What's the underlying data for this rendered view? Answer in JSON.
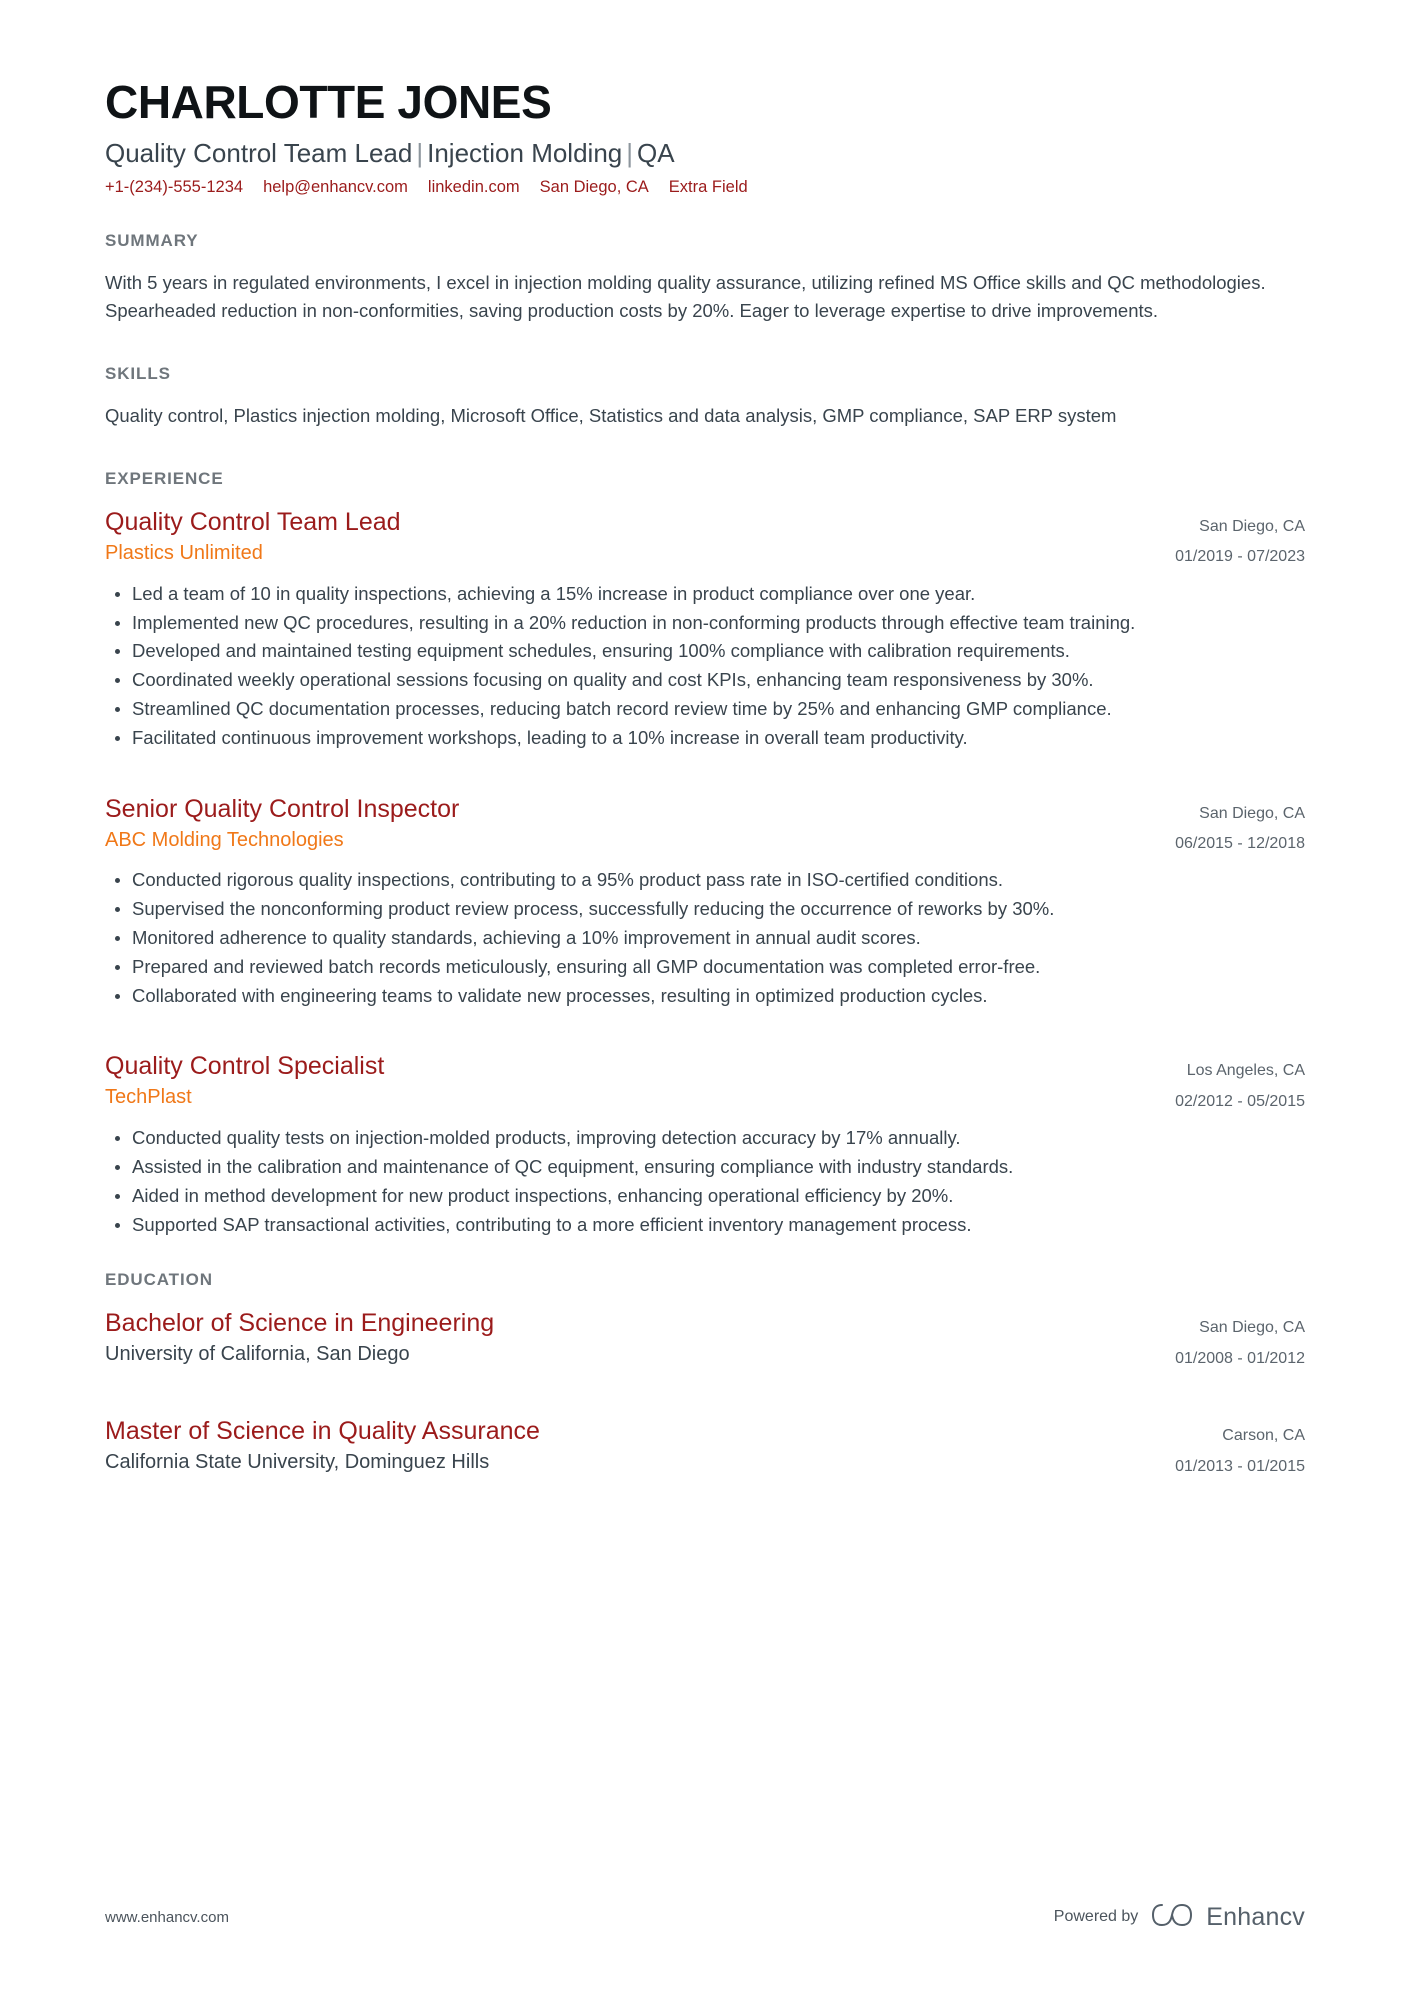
{
  "header": {
    "name": "CHARLOTTE JONES",
    "headline_parts": [
      "Quality Control Team Lead",
      "Injection Molding",
      "QA"
    ],
    "headline_separator": "|",
    "contacts": [
      {
        "name": "phone",
        "text": "+1-(234)-555-1234"
      },
      {
        "name": "email",
        "text": "help@enhancv.com"
      },
      {
        "name": "linkedin",
        "text": "linkedin.com"
      },
      {
        "name": "location",
        "text": "San Diego, CA"
      },
      {
        "name": "extra-field",
        "text": "Extra Field"
      }
    ]
  },
  "summary": {
    "title": "SUMMARY",
    "text": "With 5 years in regulated environments, I excel in injection molding quality assurance, utilizing refined MS Office skills and QC methodologies. Spearheaded reduction in non-conformities, saving production costs by 20%. Eager to leverage expertise to drive improvements."
  },
  "skills": {
    "title": "SKILLS",
    "text": "Quality control, Plastics injection molding, Microsoft Office, Statistics and data analysis, GMP compliance, SAP ERP system"
  },
  "experience": {
    "title": "EXPERIENCE",
    "entries": [
      {
        "role": "Quality Control Team Lead",
        "company": "Plastics Unlimited",
        "location": "San Diego, CA",
        "dates": "01/2019 - 07/2023",
        "bullets": [
          "Led a team of 10 in quality inspections, achieving a 15% increase in product compliance over one year.",
          "Implemented new QC procedures, resulting in a 20% reduction in non-conforming products through effective team training.",
          "Developed and maintained testing equipment schedules, ensuring 100% compliance with calibration requirements.",
          "Coordinated weekly operational sessions focusing on quality and cost KPIs, enhancing team responsiveness by 30%.",
          "Streamlined QC documentation processes, reducing batch record review time by 25% and enhancing GMP compliance.",
          "Facilitated continuous improvement workshops, leading to a 10% increase in overall team productivity."
        ]
      },
      {
        "role": "Senior Quality Control Inspector",
        "company": "ABC Molding Technologies",
        "location": "San Diego, CA",
        "dates": "06/2015 - 12/2018",
        "bullets": [
          "Conducted rigorous quality inspections, contributing to a 95% product pass rate in ISO-certified conditions.",
          "Supervised the nonconforming product review process, successfully reducing the occurrence of reworks by 30%.",
          "Monitored adherence to quality standards, achieving a 10% improvement in annual audit scores.",
          "Prepared and reviewed batch records meticulously, ensuring all GMP documentation was completed error-free.",
          "Collaborated with engineering teams to validate new processes, resulting in optimized production cycles."
        ]
      },
      {
        "role": "Quality Control Specialist",
        "company": "TechPlast",
        "location": "Los Angeles, CA",
        "dates": "02/2012 - 05/2015",
        "bullets": [
          "Conducted quality tests on injection-molded products, improving detection accuracy by 17% annually.",
          "Assisted in the calibration and maintenance of QC equipment, ensuring compliance with industry standards.",
          "Aided in method development for new product inspections, enhancing operational efficiency by 20%.",
          "Supported SAP transactional activities, contributing to a more efficient inventory management process."
        ]
      }
    ]
  },
  "education": {
    "title": "EDUCATION",
    "entries": [
      {
        "degree": "Bachelor of Science in Engineering",
        "school": "University of California, San Diego",
        "location": "San Diego, CA",
        "dates": "01/2008 - 01/2012"
      },
      {
        "degree": "Master of Science in Quality Assurance",
        "school": "California State University, Dominguez Hills",
        "location": "Carson, CA",
        "dates": "01/2013 - 01/2015"
      }
    ]
  },
  "footer": {
    "website": "www.enhancv.com",
    "powered_by": "Powered by",
    "brand": "Enhancv"
  },
  "colors": {
    "accent_red": "#9b1b1b",
    "accent_orange": "#f07818",
    "body_text": "#39444d",
    "section_label": "#6f767c"
  }
}
